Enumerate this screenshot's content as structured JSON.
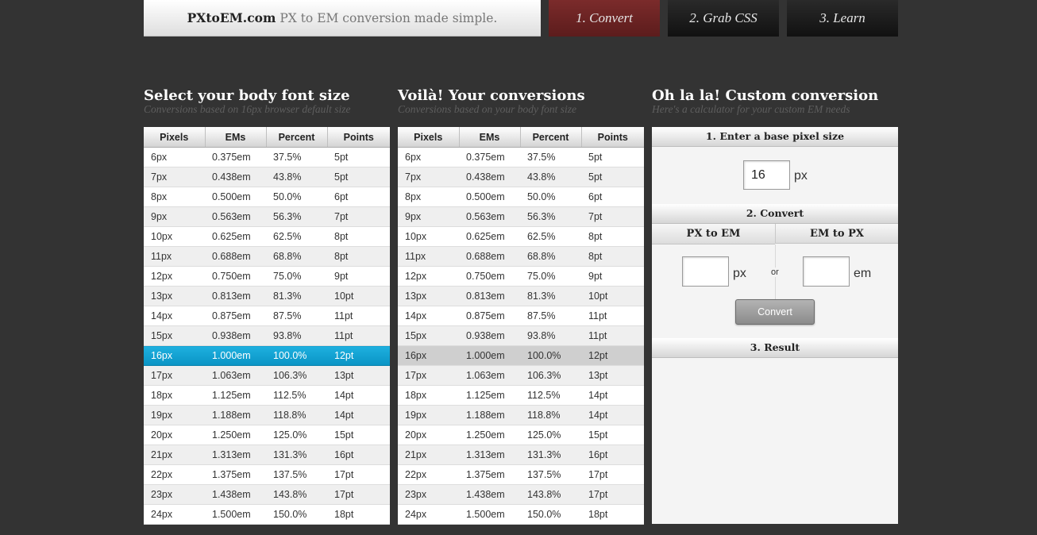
{
  "header": {
    "brand_name": "PXtoEM.com",
    "brand_tagline": "PX to EM conversion made simple.",
    "tabs": [
      {
        "label": "1. Convert"
      },
      {
        "label": "2. Grab CSS"
      },
      {
        "label": "3. Learn"
      }
    ],
    "active_tab_color": "#6b2424"
  },
  "left": {
    "title": "Select your body font size",
    "subtitle": "Conversions based on 16px browser default size",
    "selected_row": "16px",
    "selected_color": "#12a3d3"
  },
  "middle": {
    "title": "Voilà! Your conversions",
    "subtitle": "Conversions based on your body font size",
    "selected_row": "16px"
  },
  "right": {
    "title": "Oh la la! Custom conversion",
    "subtitle": "Here's a calculator for your custom EM needs",
    "step1": "1. Enter a base pixel size",
    "base_value": "16",
    "base_unit": "px",
    "step2": "2. Convert",
    "px_to_em": "PX to EM",
    "em_to_px": "EM to PX",
    "px_value": "",
    "px_unit": "px",
    "or_label": "or",
    "em_value": "",
    "em_unit": "em",
    "convert_label": "Convert",
    "step3": "3. Result"
  },
  "table": {
    "headers": [
      "Pixels",
      "EMs",
      "Percent",
      "Points"
    ],
    "rows": [
      [
        "6px",
        "0.375em",
        "37.5%",
        "5pt"
      ],
      [
        "7px",
        "0.438em",
        "43.8%",
        "5pt"
      ],
      [
        "8px",
        "0.500em",
        "50.0%",
        "6pt"
      ],
      [
        "9px",
        "0.563em",
        "56.3%",
        "7pt"
      ],
      [
        "10px",
        "0.625em",
        "62.5%",
        "8pt"
      ],
      [
        "11px",
        "0.688em",
        "68.8%",
        "8pt"
      ],
      [
        "12px",
        "0.750em",
        "75.0%",
        "9pt"
      ],
      [
        "13px",
        "0.813em",
        "81.3%",
        "10pt"
      ],
      [
        "14px",
        "0.875em",
        "87.5%",
        "11pt"
      ],
      [
        "15px",
        "0.938em",
        "93.8%",
        "11pt"
      ],
      [
        "16px",
        "1.000em",
        "100.0%",
        "12pt"
      ],
      [
        "17px",
        "1.063em",
        "106.3%",
        "13pt"
      ],
      [
        "18px",
        "1.125em",
        "112.5%",
        "14pt"
      ],
      [
        "19px",
        "1.188em",
        "118.8%",
        "14pt"
      ],
      [
        "20px",
        "1.250em",
        "125.0%",
        "15pt"
      ],
      [
        "21px",
        "1.313em",
        "131.3%",
        "16pt"
      ],
      [
        "22px",
        "1.375em",
        "137.5%",
        "17pt"
      ],
      [
        "23px",
        "1.438em",
        "143.8%",
        "17pt"
      ],
      [
        "24px",
        "1.500em",
        "150.0%",
        "18pt"
      ]
    ]
  }
}
